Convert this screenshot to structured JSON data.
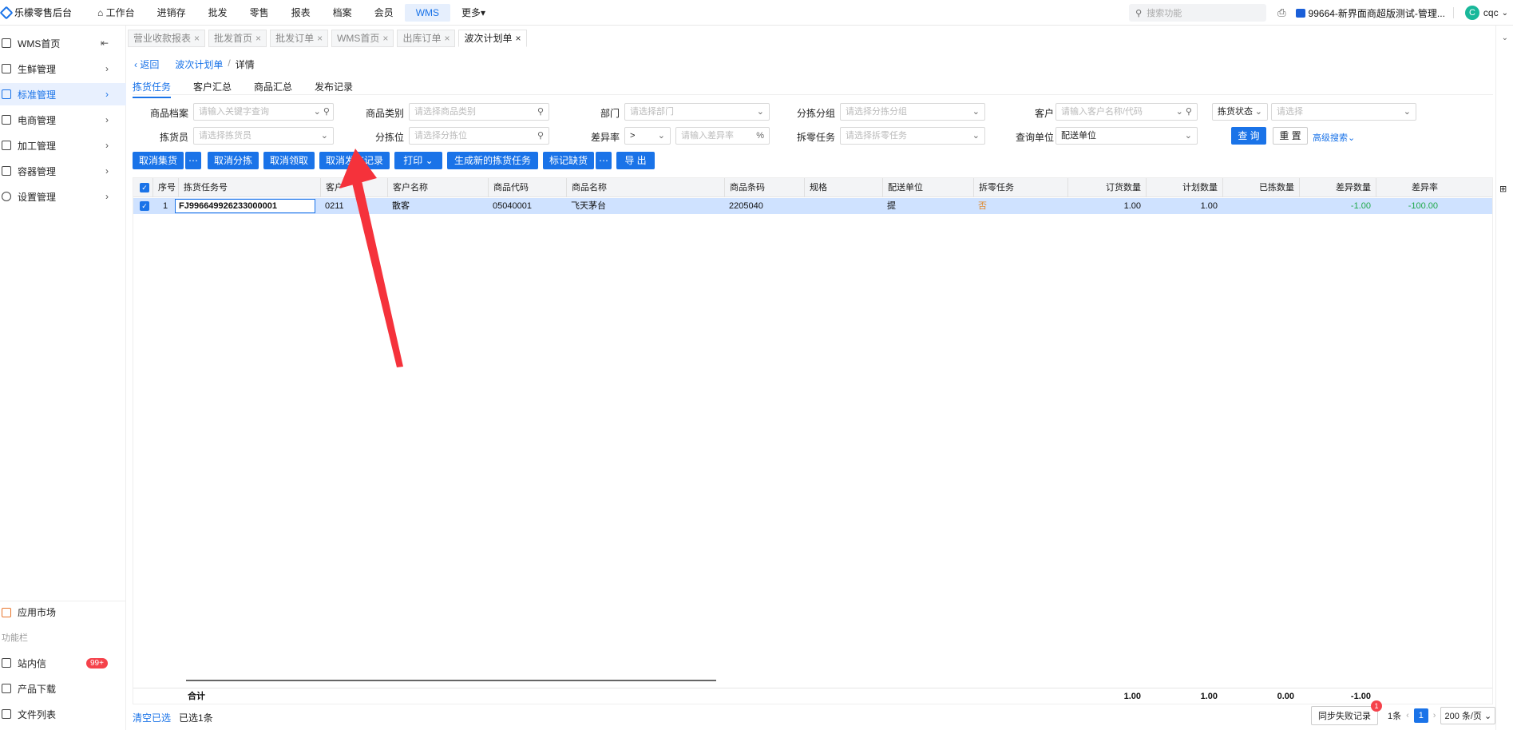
{
  "app": {
    "title": "乐檬零售后台"
  },
  "topnav": [
    "工作台",
    "进销存",
    "批发",
    "零售",
    "报表",
    "档案",
    "会员",
    "WMS",
    "更多"
  ],
  "search": {
    "placeholder": "搜索功能"
  },
  "store": {
    "label": "99664-新界面商超版测试-管理...",
    "avatar": "C",
    "user": "cqc"
  },
  "sidebar": {
    "items": [
      "WMS首页",
      "生鲜管理",
      "标准管理",
      "电商管理",
      "加工管理",
      "容器管理",
      "设置管理"
    ],
    "bottom": [
      "应用市场"
    ],
    "section": "功能栏",
    "extras": [
      "站内信",
      "产品下载",
      "文件列表"
    ],
    "badge": "99+"
  },
  "tabs": [
    "营业收款报表",
    "批发首页",
    "批发订单",
    "WMS首页",
    "出库订单",
    "波次计划单"
  ],
  "breadcrumb": {
    "back": "返回",
    "parent": "波次计划单",
    "sep": "/",
    "current": "详情"
  },
  "subtabs": [
    "拣货任务",
    "客户汇总",
    "商品汇总",
    "发布记录"
  ],
  "filters": {
    "row1": [
      {
        "label": "商品档案",
        "placeholder": "请输入关键字查询"
      },
      {
        "label": "商品类别",
        "placeholder": "请选择商品类别"
      },
      {
        "label": "部门",
        "placeholder": "请选择部门"
      },
      {
        "label": "分拣分组",
        "placeholder": "请选择分拣分组"
      },
      {
        "label": "客户",
        "placeholder": "请输入客户名称/代码"
      },
      {
        "label": "拣货状态",
        "placeholder": "请选择"
      }
    ],
    "row2": [
      {
        "label": "拣货员",
        "placeholder": "请选择拣货员"
      },
      {
        "label": "分拣位",
        "placeholder": "请选择分拣位"
      },
      {
        "label": "差异率",
        "op": ">",
        "placeholder": "请输入差异率",
        "suffix": "%"
      },
      {
        "label": "拆零任务",
        "placeholder": "请选择拆零任务"
      },
      {
        "label": "查询单位",
        "value": "配送单位"
      }
    ],
    "query": "查 询",
    "reset": "重 置",
    "advanced": "高级搜索"
  },
  "actions": [
    "取消集货",
    "取消分拣",
    "取消领取",
    "取消发布记录",
    "打印",
    "生成新的拣货任务",
    "标记缺货",
    "导 出"
  ],
  "table": {
    "columns": [
      "序号",
      "拣货任务号",
      "客户",
      "客户名称",
      "商品代码",
      "商品名称",
      "商品条码",
      "规格",
      "配送单位",
      "拆零任务",
      "订货数量",
      "计划数量",
      "已拣数量",
      "差异数量",
      "差异率"
    ],
    "rows": [
      {
        "no": "1",
        "task": "FJ996649926233000001",
        "cust": "0211",
        "custname": "散客",
        "code": "05040001",
        "name": "飞天茅台",
        "barcode": "2205040",
        "spec": "",
        "unit": "提",
        "split": "否",
        "ordered": "1.00",
        "planned": "1.00",
        "picked": "",
        "diff": "-1.00",
        "rate": "-100.00"
      }
    ],
    "total": {
      "label": "合计",
      "ordered": "1.00",
      "planned": "1.00",
      "picked": "0.00",
      "diff": "-1.00"
    }
  },
  "footer": {
    "clear": "清空已选",
    "selected": "已选1条",
    "sync": "同步失败记录",
    "sync_badge": "1",
    "count_tail": "1条",
    "page": "1",
    "page_size": "200 条/页"
  },
  "colors": {
    "accent": "#1a73e8",
    "row_selected": "#cfe2ff",
    "diff_green": "#20a84a",
    "split_orange": "#e08a2c",
    "arrow": "#f5323b"
  }
}
